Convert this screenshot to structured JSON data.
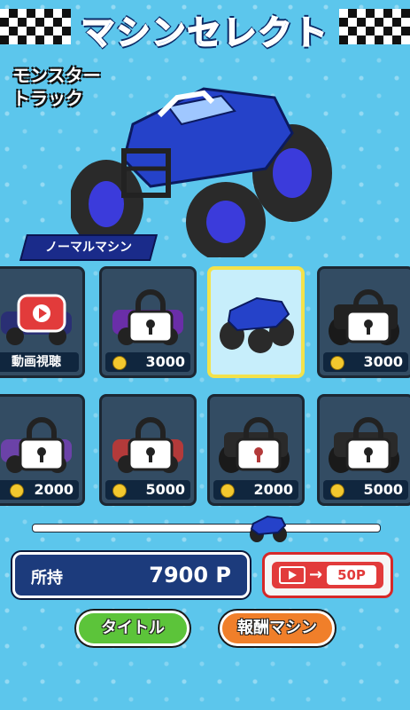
{
  "title": "マシンセレクト",
  "selected_car": {
    "name_line1": "モンスター",
    "name_line2": "トラック",
    "type_badge": "ノーマルマシン"
  },
  "cars": [
    {
      "slot": "video",
      "label": "動画視聴",
      "locked": false,
      "color": "#2a2f74"
    },
    {
      "slot": "locked",
      "price": "3000",
      "locked": true,
      "color": "#6a2ea8"
    },
    {
      "slot": "selected",
      "locked": false,
      "color": "#2542c9"
    },
    {
      "slot": "locked",
      "price": "3000",
      "locked": true,
      "color": "#222222"
    },
    {
      "slot": "locked",
      "price": "2000",
      "locked": true,
      "color": "#6b42a8"
    },
    {
      "slot": "locked",
      "price": "5000",
      "locked": true,
      "color": "#b33a3a"
    },
    {
      "slot": "locked",
      "price": "2000",
      "locked": true,
      "color": "#2a2a2a"
    },
    {
      "slot": "locked",
      "price": "5000",
      "locked": true,
      "color": "#2a2a2a"
    }
  ],
  "slider": {
    "position_fraction": 0.68
  },
  "points": {
    "label": "所持",
    "value": "7900 P"
  },
  "video_reward": {
    "arrow": "→",
    "value": "50P"
  },
  "buttons": {
    "title": "タイトル",
    "reward": "報酬マシン"
  },
  "colors": {
    "background": "#5cc6ec",
    "selected_border": "#f3e24a",
    "accent_red": "#e23b3b",
    "title_btn": "#5cc43a",
    "reward_btn": "#f07f2a"
  }
}
